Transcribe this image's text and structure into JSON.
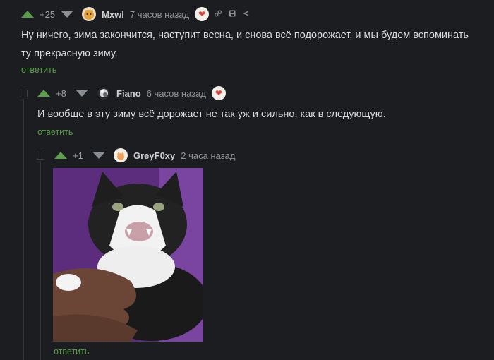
{
  "comments": [
    {
      "rating": "+25",
      "username": "Mxwl",
      "time": "7 часов назад",
      "text": "Ну ничего, зима закончится, наступит весна, и снова всё подорожает, и мы будем вспоминать ту прекрасную зиму.",
      "reply_label": "ответить"
    },
    {
      "rating": "+8",
      "username": "Fiano",
      "time": "6 часов назад",
      "text": "И вообще в эту зиму всё дорожает не так уж и сильно, как в следующую.",
      "reply_label": "ответить"
    },
    {
      "rating": "+1",
      "username": "GreyF0xy",
      "time": "2 часа назад",
      "reply_label": "ответить"
    }
  ],
  "icons": {
    "link": "link-icon",
    "save": "save-icon",
    "share": "share-icon",
    "badge": "heart-badge-icon"
  },
  "colors": {
    "background": "#1b1d20",
    "accent_green": "#5a9e4a",
    "text": "#dcdcdc",
    "muted": "#8f949a"
  }
}
